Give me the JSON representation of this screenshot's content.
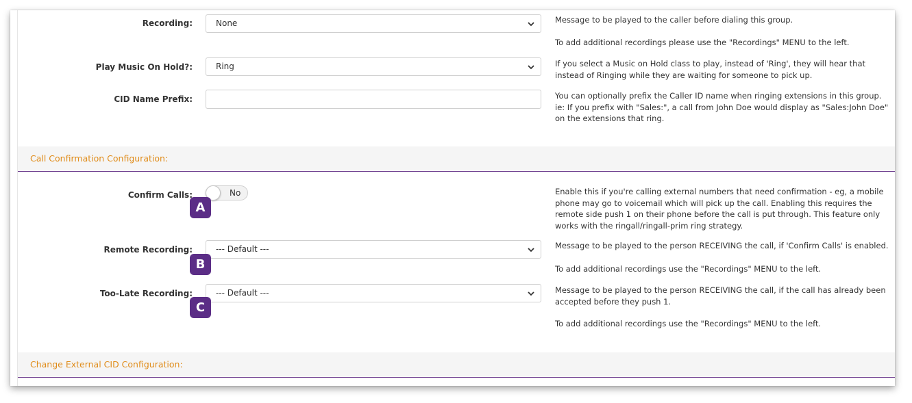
{
  "recording": {
    "label": "Recording:",
    "value": "None",
    "help1": "Message to be played to the caller before dialing this group.",
    "help2": "To add additional recordings please use the \"Recordings\" MENU to the left."
  },
  "music_on_hold": {
    "label": "Play Music On Hold?:",
    "value": "Ring",
    "help": "If you select a Music on Hold class to play, instead of 'Ring', they will hear that instead of Ringing while they are waiting for someone to pick up."
  },
  "cid_name_prefix": {
    "label": "CID Name Prefix:",
    "value": "",
    "help": "You can optionally prefix the Caller ID name when ringing extensions in this group. ie: If you prefix with \"Sales:\", a call from John Doe would display as \"Sales:John Doe\" on the extensions that ring."
  },
  "call_confirmation_section": {
    "title": "Call Confirmation Configuration:"
  },
  "confirm_calls": {
    "label": "Confirm Calls:",
    "value": "No",
    "help": "Enable this if you're calling external numbers that need confirmation - eg, a mobile phone may go to voicemail which will pick up the call. Enabling this requires the remote side push 1 on their phone before the call is put through. This feature only works with the ringall/ringall-prim ring strategy."
  },
  "remote_recording": {
    "label": "Remote Recording:",
    "value": "--- Default ---",
    "help1": "Message to be played to the person RECEIVING the call, if 'Confirm Calls' is enabled.",
    "help2": "To add additional recordings use the \"Recordings\" MENU to the left."
  },
  "too_late_recording": {
    "label": "Too-Late Recording:",
    "value": "--- Default ---",
    "help1": "Message to be played to the person RECEIVING the call, if the call has already been accepted before they push 1.",
    "help2": "To add additional recordings use the \"Recordings\" MENU to the left."
  },
  "change_external_cid_section": {
    "title": "Change External CID Configuration:"
  },
  "markers": {
    "a": "A",
    "b": "B",
    "c": "C"
  },
  "colors": {
    "section_title": "#e08c1a",
    "section_rule": "#6b3a8c",
    "marker_bg": "#5b2d86"
  },
  "icons": {
    "select_arrow": "chevron-down-icon"
  }
}
